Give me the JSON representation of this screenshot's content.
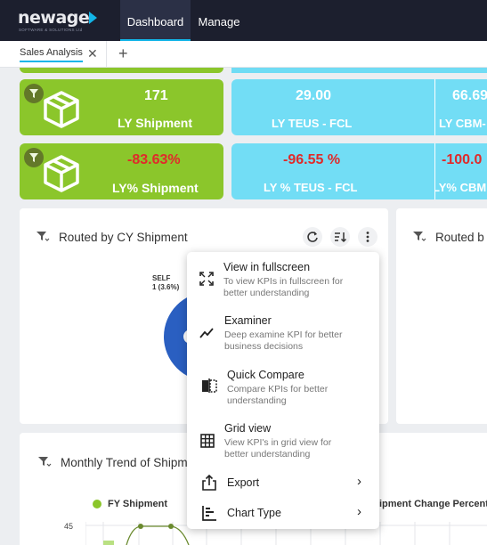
{
  "header": {
    "logo_text": "newage",
    "logo_subtitle": "SOFTWARE & SOLUTIONS Ltd",
    "tabs": [
      {
        "label": "Dashboard",
        "active": true
      },
      {
        "label": "Manage",
        "active": false
      }
    ],
    "accent_color": "#12b5e8"
  },
  "subtabs": {
    "items": [
      {
        "label": "Sales Analysis"
      }
    ],
    "add_symbol": "+",
    "close_symbol": "✕"
  },
  "kpis": [
    {
      "value": "171",
      "label": "LY Shipment",
      "type": "green",
      "icon": "package-icon"
    },
    {
      "value": "29.00",
      "label": "LY TEUS - FCL",
      "type": "cyan"
    },
    {
      "value": "66.69",
      "label": "LY CBM-",
      "type": "cyan"
    },
    {
      "value": "-83.63%",
      "label": "LY% Shipment",
      "type": "green",
      "negative": true,
      "icon": "package-icon"
    },
    {
      "value": "-96.55 %",
      "label": "LY % TEUS - FCL",
      "type": "cyan",
      "negative": true
    },
    {
      "value": "-100.0",
      "label": "LY% CBM",
      "type": "cyan",
      "negative": true
    }
  ],
  "colors": {
    "green": "#8bc62b",
    "cyan": "#72ddf5",
    "negative": "#e02a2a",
    "pie_blue": "#2a5fc1"
  },
  "cards": {
    "routed": {
      "title": "Routed by CY Shipment",
      "pie_label_line1": "SELF",
      "pie_label_line2": "1 (3.6%)",
      "refresh_icon": "refresh-icon",
      "sort_icon": "sort-icon",
      "more_icon": "more-vertical-icon"
    },
    "routed_partial": {
      "title": "Routed b"
    },
    "monthly": {
      "title": "Monthly Trend of Shipm",
      "legend": [
        {
          "label": "FY Shipment"
        },
        {
          "label": "ipment Change Percent"
        }
      ],
      "y_tick": "45"
    }
  },
  "menu": {
    "items": [
      {
        "title": "View in fullscreen",
        "desc": "To view KPIs in fullscreen for better understanding",
        "icon": "fullscreen-icon"
      },
      {
        "title": "Examiner",
        "desc": "Deep examine KPI for better business decisions",
        "icon": "trend-line-icon"
      },
      {
        "title": "Quick Compare",
        "desc": "Compare KPIs for better understanding",
        "icon": "compare-icon"
      },
      {
        "title": "Grid view",
        "desc": "View KPI's in grid view for better understanding",
        "icon": "grid-icon"
      },
      {
        "title": "Export",
        "icon": "export-icon",
        "submenu": true
      },
      {
        "title": "Chart Type",
        "icon": "chart-type-icon",
        "submenu": true
      }
    ]
  }
}
